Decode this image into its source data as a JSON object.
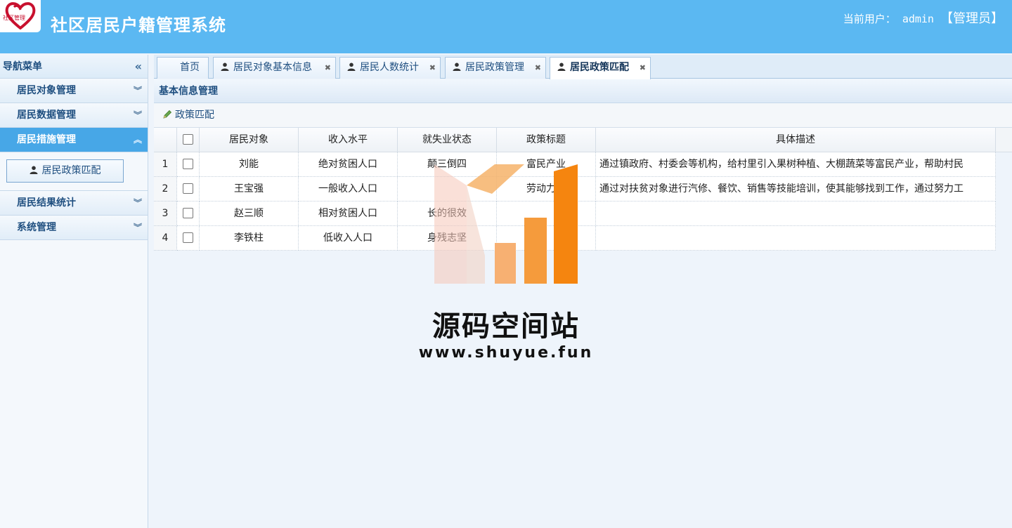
{
  "header": {
    "logo_text": "社区管理",
    "title": "社区居民户籍管理系统",
    "user_label": "当前用户：",
    "username": "admin",
    "role": "【管理员】"
  },
  "sidebar": {
    "title": "导航菜单",
    "items": [
      {
        "label": "居民对象管理"
      },
      {
        "label": "居民数据管理"
      },
      {
        "label": "居民措施管理"
      },
      {
        "label": "居民结果统计"
      },
      {
        "label": "系统管理"
      }
    ],
    "sub_item": "居民政策匹配"
  },
  "tabs": [
    {
      "label": "首页"
    },
    {
      "label": "居民对象基本信息"
    },
    {
      "label": "居民人数统计"
    },
    {
      "label": "居民政策管理"
    },
    {
      "label": "居民政策匹配"
    }
  ],
  "panel": {
    "title": "基本信息管理",
    "toolbar_button": "政策匹配"
  },
  "table": {
    "columns": [
      "居民对象",
      "收入水平",
      "就失业状态",
      "政策标题",
      "具体描述"
    ],
    "rows": [
      {
        "num": "1",
        "name": "刘能",
        "income": "绝对贫困人口",
        "status": "颠三倒四",
        "policy": "富民产业",
        "desc": "通过镇政府、村委会等机构，给村里引入果树种植、大棚蔬菜等富民产业，帮助村民"
      },
      {
        "num": "2",
        "name": "王宝强",
        "income": "一般收入人口",
        "status": "",
        "policy": "劳动力培",
        "desc": "通过对扶贫对象进行汽修、餐饮、销售等技能培训，使其能够找到工作，通过努力工"
      },
      {
        "num": "3",
        "name": "赵三顺",
        "income": "相对贫困人口",
        "status": "长的很效",
        "policy": "",
        "desc": ""
      },
      {
        "num": "4",
        "name": "李铁柱",
        "income": "低收入人口",
        "status": "身残志坚",
        "policy": "",
        "desc": ""
      }
    ]
  },
  "watermark": {
    "title": "源码空间站",
    "url": "www.shuyue.fun"
  }
}
